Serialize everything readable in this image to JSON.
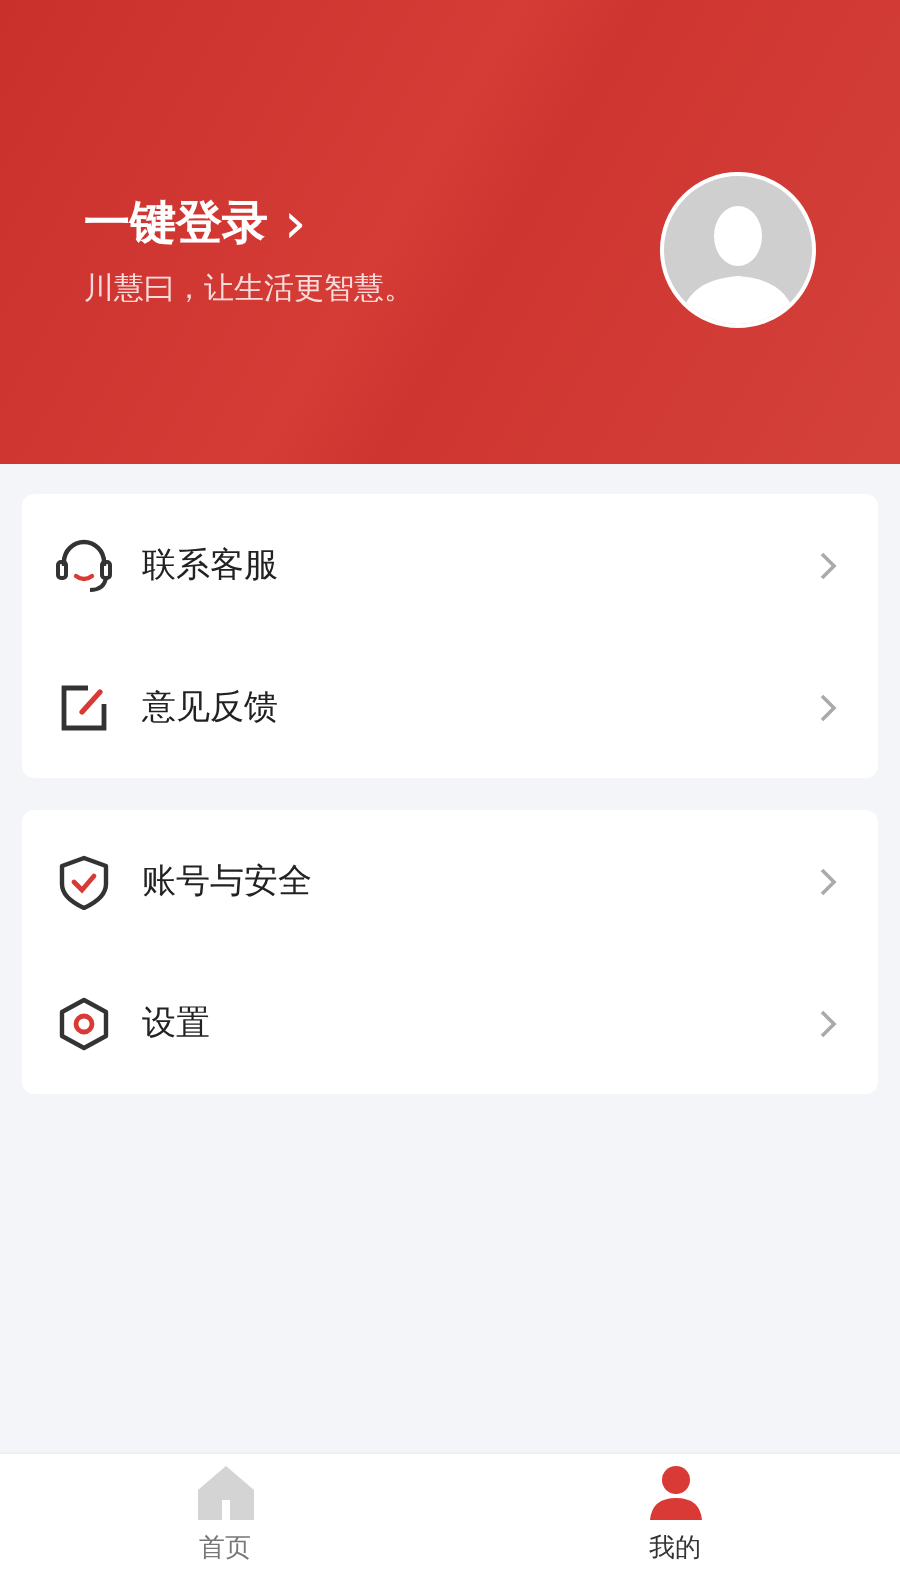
{
  "header": {
    "login": "一键登录",
    "chevron": "›",
    "slogan": "川慧曰，让生活更智慧。"
  },
  "groups": [
    {
      "items": [
        {
          "kind": "headset",
          "label": "联系客服"
        },
        {
          "kind": "edit",
          "label": "意见反馈"
        }
      ]
    },
    {
      "items": [
        {
          "kind": "shield",
          "label": "账号与安全"
        },
        {
          "kind": "settings",
          "label": "设置"
        }
      ]
    }
  ],
  "tabs": [
    {
      "kind": "home",
      "label": "首页",
      "selected": false
    },
    {
      "kind": "mine",
      "label": "我的",
      "selected": true
    }
  ]
}
